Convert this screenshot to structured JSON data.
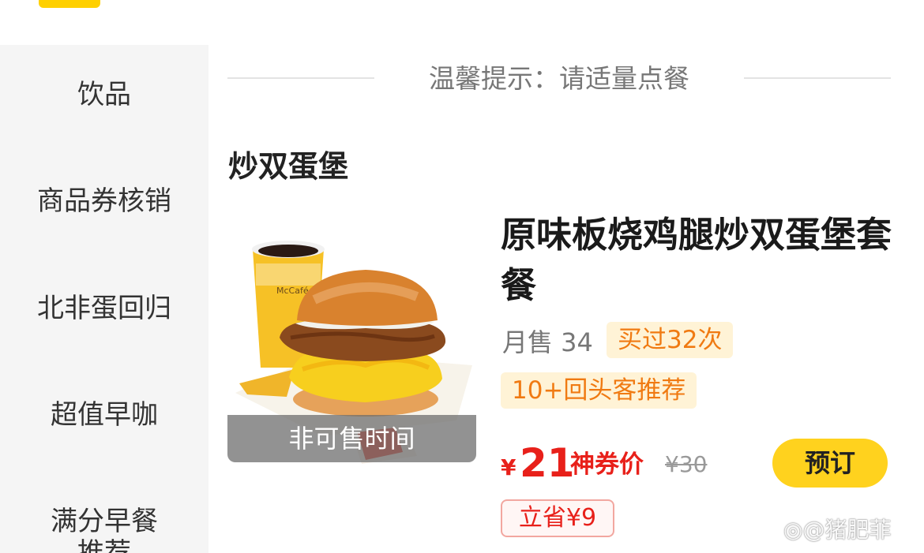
{
  "sidebar": {
    "items": [
      {
        "label": "饮品"
      },
      {
        "label": "商品券核销"
      },
      {
        "label": "北非蛋回归"
      },
      {
        "label": "超值早咖"
      },
      {
        "label": "满分早餐"
      },
      {
        "label": "推荐"
      }
    ]
  },
  "notice": {
    "text": "温馨提示：请适量点餐"
  },
  "section": {
    "title": "炒双蛋堡"
  },
  "product": {
    "name": "原味板烧鸡腿炒双蛋堡套餐",
    "unavailable_label": "非可售时间",
    "monthly_sales": "月售 34",
    "bought_tag": "买过32次",
    "repeat_tag": "10+回头客推荐",
    "price_symbol": "¥",
    "price": "21",
    "price_label": "神券价",
    "original_price": "¥30",
    "order_label": "预订",
    "save_label": "立省¥9",
    "image_logo_text": "McCafé"
  },
  "watermark": {
    "text": "@猪肥菲"
  },
  "colors": {
    "accent": "#FFD000",
    "price": "#E8201A",
    "tag_bg": "#FFF3D6",
    "tag_text": "#F07A12",
    "sidebar_bg": "#f5f5f5"
  },
  "icons": {
    "product_image": "burger-combo-photo",
    "weibo": "weibo-icon"
  }
}
